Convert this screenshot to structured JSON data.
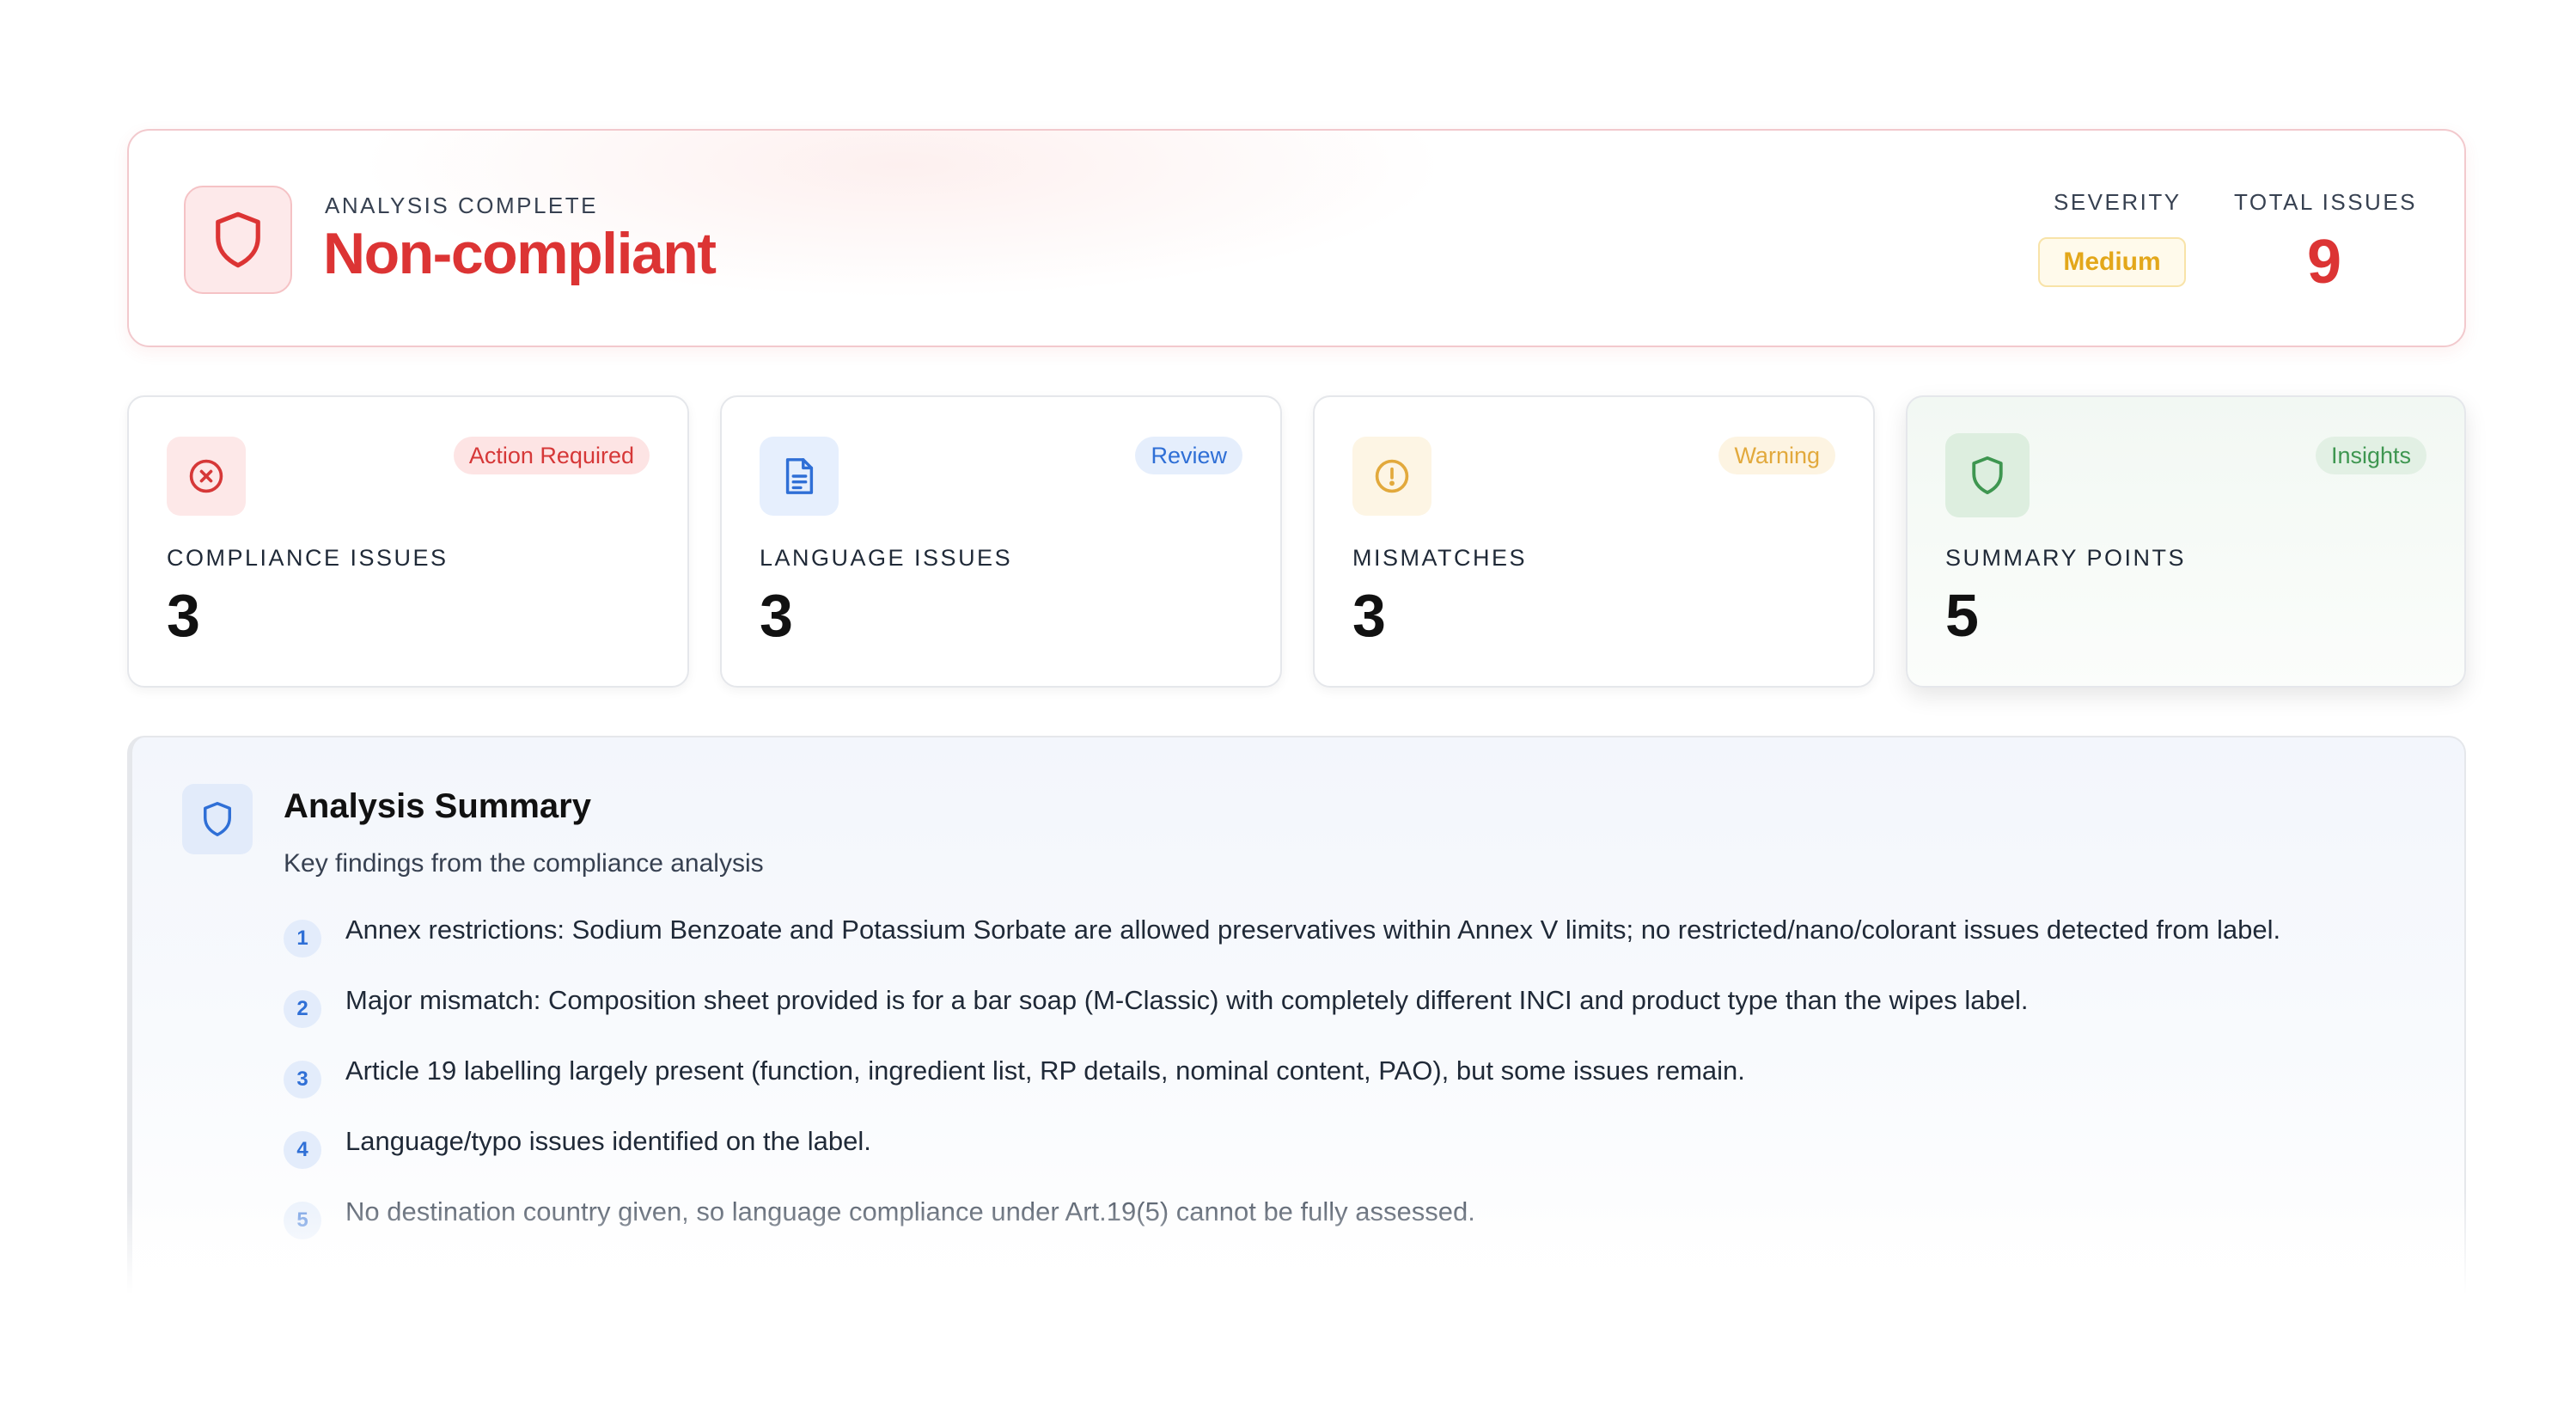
{
  "header": {
    "eyebrow": "ANALYSIS COMPLETE",
    "status": "Non-compliant",
    "severity_label": "SEVERITY",
    "severity_value": "Medium",
    "total_label": "TOTAL ISSUES",
    "total_value": "9",
    "icon": "shield-icon"
  },
  "stats": [
    {
      "label": "COMPLIANCE ISSUES",
      "value": "3",
      "badge": "Action Required",
      "icon": "x-circle-icon",
      "color": "#d63838"
    },
    {
      "label": "LANGUAGE ISSUES",
      "value": "3",
      "badge": "Review",
      "icon": "document-icon",
      "color": "#2f6fd6"
    },
    {
      "label": "MISMATCHES",
      "value": "3",
      "badge": "Warning",
      "icon": "alert-circle-icon",
      "color": "#e2a93c"
    },
    {
      "label": "SUMMARY POINTS",
      "value": "5",
      "badge": "Insights",
      "icon": "shield-icon",
      "color": "#3e9650"
    }
  ],
  "summary": {
    "title": "Analysis Summary",
    "subtitle": "Key findings from the compliance analysis",
    "icon": "shield-icon",
    "items": [
      {
        "num": "1",
        "text": "Annex restrictions: Sodium Benzoate and Potassium Sorbate are allowed preservatives within Annex V limits; no restricted/nano/colorant issues detected from label."
      },
      {
        "num": "2",
        "text": "Major mismatch: Composition sheet provided is for a bar soap (M-Classic) with completely different INCI and product type than the wipes label."
      },
      {
        "num": "3",
        "text": "Article 19 labelling largely present (function, ingredient list, RP details, nominal content, PAO), but some issues remain."
      },
      {
        "num": "4",
        "text": "Language/typo issues identified on the label."
      },
      {
        "num": "5",
        "text": "No destination country given, so language compliance under Art.19(5) cannot be fully assessed."
      }
    ]
  },
  "colors": {
    "danger": "#dc3434",
    "warning": "#e3a71a",
    "info": "#2f6fd6",
    "success": "#3e9650"
  }
}
